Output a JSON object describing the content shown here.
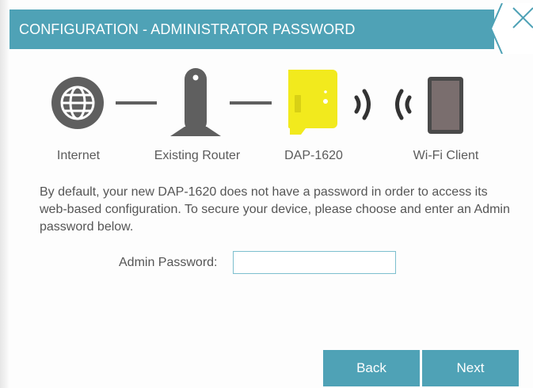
{
  "header": {
    "title": "CONFIGURATION - ADMINISTRATOR PASSWORD",
    "close_icon": "close-x-icon"
  },
  "diagram": {
    "nodes": [
      {
        "label": "Internet",
        "icon": "globe-icon"
      },
      {
        "label": "Existing Router",
        "icon": "router-icon"
      },
      {
        "label": "DAP-1620",
        "icon": "range-extender-icon"
      },
      {
        "label": "Wi-Fi Client",
        "icon": "tablet-icon"
      }
    ],
    "colors": {
      "icon": "#5f5f5f",
      "device_accent": "#f2ea1d",
      "header": "#4fa2b6"
    }
  },
  "content": {
    "description": "By default, your new DAP-1620 does not have a password in order to access its web-based configuration. To secure your device, please choose and enter an Admin password below.",
    "password_label": "Admin Password:",
    "password_value": ""
  },
  "buttons": {
    "back": "Back",
    "next": "Next"
  }
}
